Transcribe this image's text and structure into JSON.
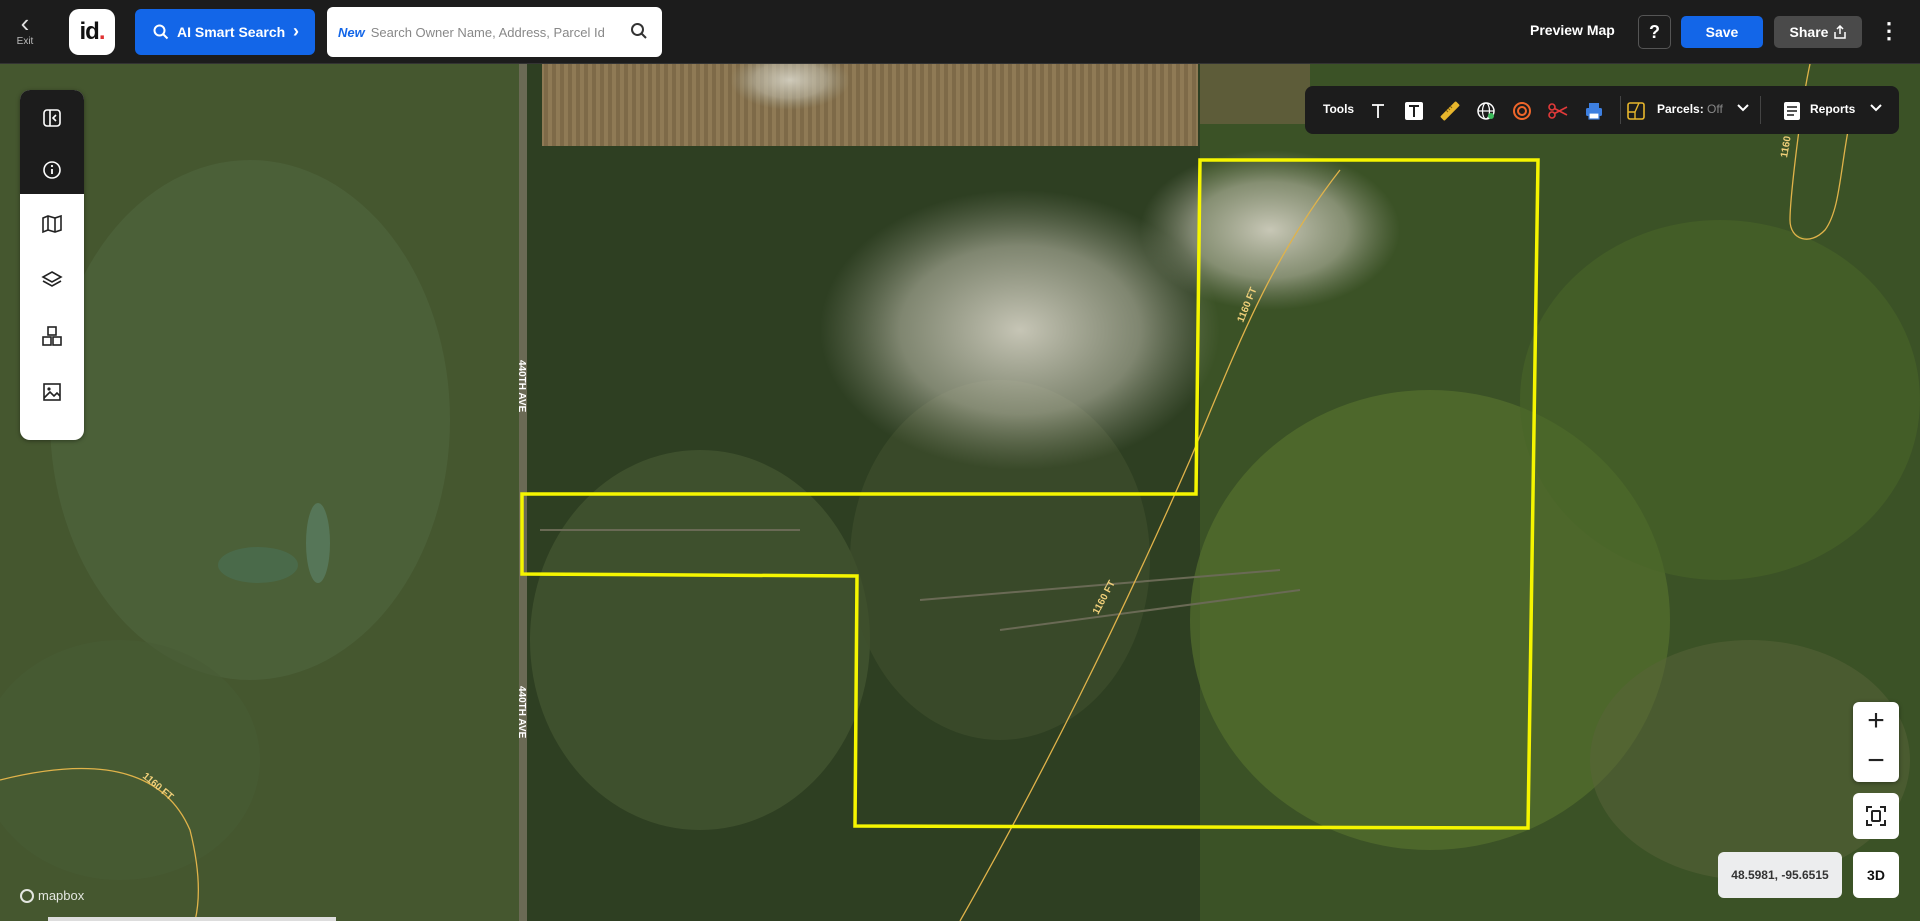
{
  "header": {
    "exit_label": "Exit",
    "logo_text": "id",
    "ai_search_label": "AI Smart Search",
    "search": {
      "new_tag": "New",
      "placeholder": "Search Owner Name, Address, Parcel Id"
    },
    "preview_label": "Preview Map",
    "help_label": "?",
    "save_label": "Save",
    "share_label": "Share"
  },
  "rail": {
    "items": [
      {
        "icon": "collapse-panel-icon"
      },
      {
        "icon": "info-icon"
      },
      {
        "icon": "map-icon"
      },
      {
        "icon": "layers-icon"
      },
      {
        "icon": "buildings-icon"
      },
      {
        "icon": "image-icon"
      }
    ]
  },
  "toolbar": {
    "tools_label": "Tools",
    "tools": [
      "text-icon",
      "text-box-icon",
      "ruler-icon",
      "globe-icon",
      "radius-icon",
      "scissors-icon",
      "print-icon"
    ],
    "parcels_label": "Parcels:",
    "parcels_state": "Off",
    "reports_label": "Reports"
  },
  "map": {
    "road_labels": [
      "440TH AVE",
      "440TH AVE"
    ],
    "contour_labels": [
      "1160 FT",
      "1160 FT",
      "1160 FT",
      "1160"
    ],
    "coordinates": "48.5981, -95.6515",
    "three_d_label": "3D",
    "attribution": "mapbox",
    "parcel_color": "#f5f500"
  }
}
